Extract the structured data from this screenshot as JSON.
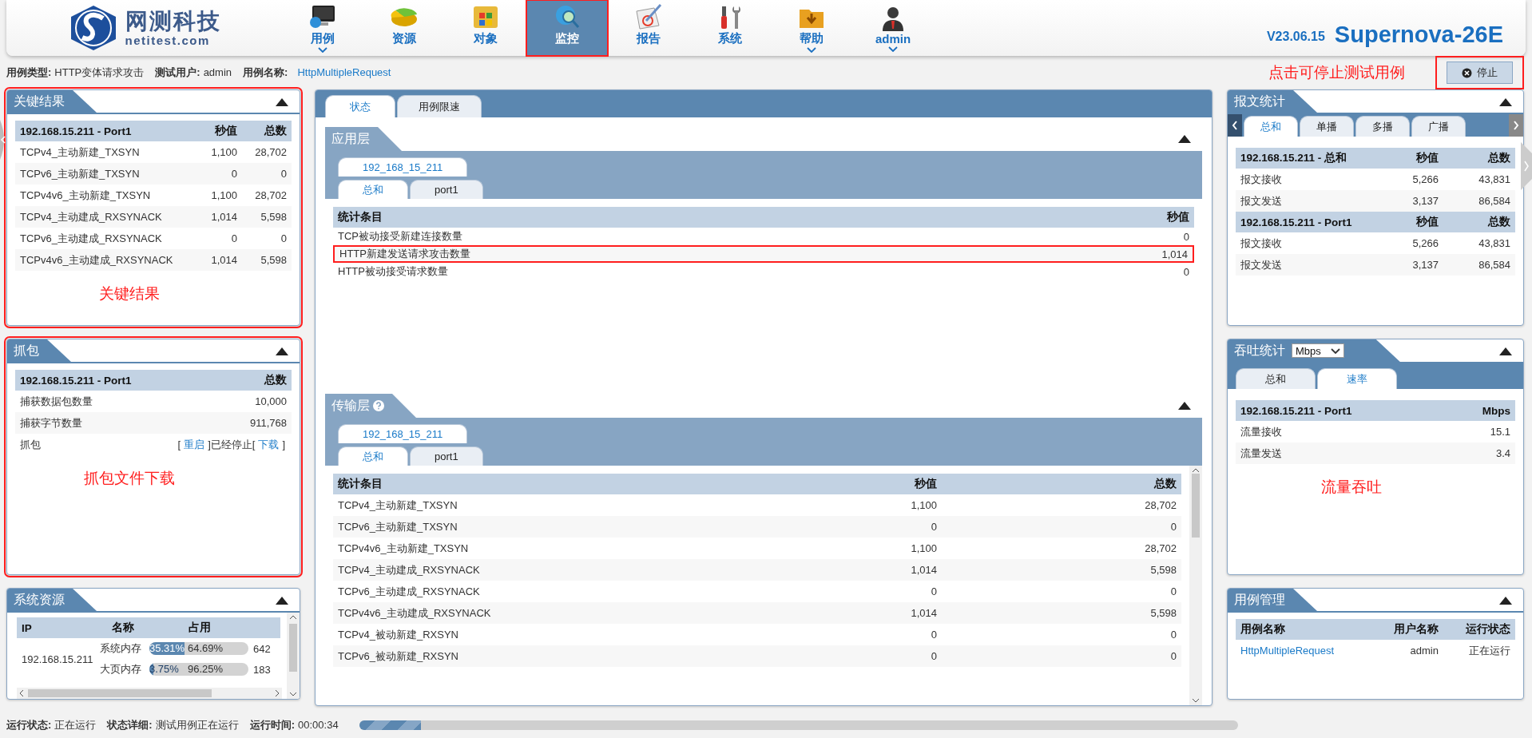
{
  "header": {
    "logo": {
      "name": "网测科技",
      "domain": "netitest.com"
    },
    "nav": [
      {
        "label": "用例",
        "dropdown": true,
        "selected": false,
        "highlighted": false
      },
      {
        "label": "资源",
        "dropdown": false,
        "selected": false,
        "highlighted": false
      },
      {
        "label": "对象",
        "dropdown": false,
        "selected": false,
        "highlighted": false
      },
      {
        "label": "监控",
        "dropdown": false,
        "selected": true,
        "highlighted": true
      },
      {
        "label": "报告",
        "dropdown": false,
        "selected": false,
        "highlighted": false
      },
      {
        "label": "系统",
        "dropdown": false,
        "selected": false,
        "highlighted": false
      },
      {
        "label": "帮助",
        "dropdown": true,
        "selected": false,
        "highlighted": false
      },
      {
        "label": "admin",
        "dropdown": true,
        "selected": false,
        "highlighted": false
      }
    ],
    "version": "V23.06.15",
    "product": "Supernova-26E"
  },
  "info": [
    {
      "label": "用例类型:",
      "value": "HTTP变体请求攻击",
      "link": false
    },
    {
      "label": "测试用户:",
      "value": "admin",
      "link": false
    },
    {
      "label": "用例名称:",
      "value": "HttpMultipleRequest",
      "link": true
    }
  ],
  "stop": {
    "annotation": "点击可停止测试用例",
    "label": "停止",
    "highlighted": true
  },
  "left": [
    {
      "kind": "table",
      "title": "关键结果",
      "highlighted": true,
      "annotation": "关键结果",
      "table": {
        "columns": [
          "192.168.15.211 - Port1",
          "秒值",
          "总数"
        ],
        "rows": [
          {
            "cells": [
              "TCPv4_主动新建_TXSYN",
              "1,100",
              "28,702"
            ]
          },
          {
            "cells": [
              "TCPv6_主动新建_TXSYN",
              "0",
              "0"
            ]
          },
          {
            "cells": [
              "TCPv4v6_主动新建_TXSYN",
              "1,100",
              "28,702"
            ]
          },
          {
            "cells": [
              "TCPv4_主动建成_RXSYNACK",
              "1,014",
              "5,598"
            ]
          },
          {
            "cells": [
              "TCPv6_主动建成_RXSYNACK",
              "0",
              "0"
            ]
          },
          {
            "cells": [
              "TCPv4v6_主动建成_RXSYNACK",
              "1,014",
              "5,598"
            ]
          }
        ]
      }
    },
    {
      "kind": "table",
      "title": "抓包",
      "highlighted": true,
      "annotation": "抓包文件下载",
      "table": {
        "columns": [
          "192.168.15.211 - Port1",
          "总数"
        ],
        "rows": [
          {
            "kind": "data",
            "cells": [
              "捕获数据包数量",
              "10,000"
            ]
          },
          {
            "kind": "data",
            "cells": [
              "捕获字节数量",
              "911,768"
            ]
          },
          {
            "kind": "actions",
            "cells": [
              "抓包",
              [
                {
                  "text": "[",
                  "link": false
                },
                {
                  "text": "重启",
                  "link": true
                },
                {
                  "text": "]已经停止[",
                  "link": false
                },
                {
                  "text": "下载",
                  "link": true
                },
                {
                  "text": "]",
                  "link": false
                }
              ]
            ]
          }
        ]
      }
    },
    {
      "kind": "resources",
      "title": "系统资源",
      "highlighted": false,
      "columns": [
        "IP",
        "名称",
        "占用"
      ],
      "ip": "192.168.15.211",
      "items": [
        {
          "name": "系统内存",
          "used": "35.31%",
          "free": "64.69%",
          "level": 0.3531,
          "value": "642"
        },
        {
          "name": "大页内存",
          "used": "3.75%",
          "free": "96.25%",
          "level": 0.0375,
          "value": "183"
        }
      ]
    }
  ],
  "center": {
    "tabs": [
      {
        "label": "状态",
        "selected": true
      },
      {
        "label": "用例限速",
        "selected": false
      }
    ],
    "sections": [
      {
        "title": "应用层",
        "help": false,
        "scroll": false,
        "host_tab": {
          "label": "192_168_15_211",
          "selected": true
        },
        "tabs": [
          {
            "label": "总和",
            "selected": true
          },
          {
            "label": "port1",
            "selected": false
          }
        ],
        "table": {
          "columns": [
            "统计条目",
            "秒值"
          ],
          "rows": [
            {
              "highlighted": false,
              "cells": [
                "TCP被动接受新建连接数量",
                "0"
              ]
            },
            {
              "highlighted": true,
              "cells": [
                "HTTP新建发送请求攻击数量",
                "1,014"
              ]
            },
            {
              "highlighted": false,
              "cells": [
                "HTTP被动接受请求数量",
                "0"
              ]
            }
          ]
        }
      },
      {
        "title": "传输层",
        "help": true,
        "scroll": true,
        "host_tab": {
          "label": "192_168_15_211",
          "selected": true
        },
        "tabs": [
          {
            "label": "总和",
            "selected": true
          },
          {
            "label": "port1",
            "selected": false
          }
        ],
        "table": {
          "columns": [
            "统计条目",
            "秒值",
            "总数"
          ],
          "rows": [
            {
              "highlighted": false,
              "cells": [
                "TCPv4_主动新建_TXSYN",
                "1,100",
                "28,702"
              ]
            },
            {
              "highlighted": false,
              "cells": [
                "TCPv6_主动新建_TXSYN",
                "0",
                "0"
              ]
            },
            {
              "highlighted": false,
              "cells": [
                "TCPv4v6_主动新建_TXSYN",
                "1,100",
                "28,702"
              ]
            },
            {
              "highlighted": false,
              "cells": [
                "TCPv4_主动建成_RXSYNACK",
                "1,014",
                "5,598"
              ]
            },
            {
              "highlighted": false,
              "cells": [
                "TCPv6_主动建成_RXSYNACK",
                "0",
                "0"
              ]
            },
            {
              "highlighted": false,
              "cells": [
                "TCPv4v6_主动建成_RXSYNACK",
                "1,014",
                "5,598"
              ]
            },
            {
              "highlighted": false,
              "cells": [
                "TCPv4_被动新建_RXSYN",
                "0",
                "0"
              ]
            },
            {
              "highlighted": false,
              "cells": [
                "TCPv6_被动新建_RXSYN",
                "0",
                "0"
              ]
            }
          ]
        }
      }
    ]
  },
  "right": [
    {
      "title": "报文统计",
      "highlighted": false,
      "tabs": [
        {
          "label": "总和",
          "selected": true
        },
        {
          "label": "单播",
          "selected": false
        },
        {
          "label": "多播",
          "selected": false
        },
        {
          "label": "广播",
          "selected": false
        }
      ],
      "table": {
        "columns": [
          "192.168.15.211 - 总和",
          "秒值",
          "总数"
        ],
        "rows": [
          {
            "kind": "data",
            "cells": [
              "报文接收",
              "5,266",
              "43,831"
            ]
          },
          {
            "kind": "data",
            "cells": [
              "报文发送",
              "3,137",
              "86,584"
            ]
          },
          {
            "kind": "header",
            "cells": [
              "192.168.15.211 - Port1",
              "秒值",
              "总数"
            ]
          },
          {
            "kind": "data",
            "cells": [
              "报文接收",
              "5,266",
              "43,831"
            ]
          },
          {
            "kind": "data",
            "cells": [
              "报文发送",
              "3,137",
              "86,584"
            ]
          }
        ]
      }
    },
    {
      "title": "吞吐统计",
      "highlighted": false,
      "unit": "Mbps",
      "annotation": "流量吞吐",
      "tabs": [
        {
          "label": "总和",
          "selected": false
        },
        {
          "label": "速率",
          "selected": true
        }
      ],
      "table": {
        "columns": [
          "192.168.15.211 - Port1",
          "Mbps"
        ],
        "rows": [
          {
            "cells": [
              "流量接收",
              "15.1"
            ]
          },
          {
            "cells": [
              "流量发送",
              "3.4"
            ]
          }
        ]
      }
    },
    {
      "title": "用例管理",
      "highlighted": false,
      "table": {
        "columns": [
          "用例名称",
          "用户名称",
          "运行状态"
        ],
        "rows": [
          {
            "cells": [
              {
                "text": "HttpMultipleRequest",
                "link": true
              },
              "admin",
              "正在运行"
            ]
          }
        ]
      }
    }
  ],
  "status_bar": {
    "items": [
      {
        "label": "运行状态:",
        "value": "正在运行"
      },
      {
        "label": "状态详细:",
        "value": "测试用例正在运行"
      },
      {
        "label": "运行时间:",
        "value": "00:00:34"
      }
    ],
    "progress": {
      "level": 0.07
    }
  }
}
